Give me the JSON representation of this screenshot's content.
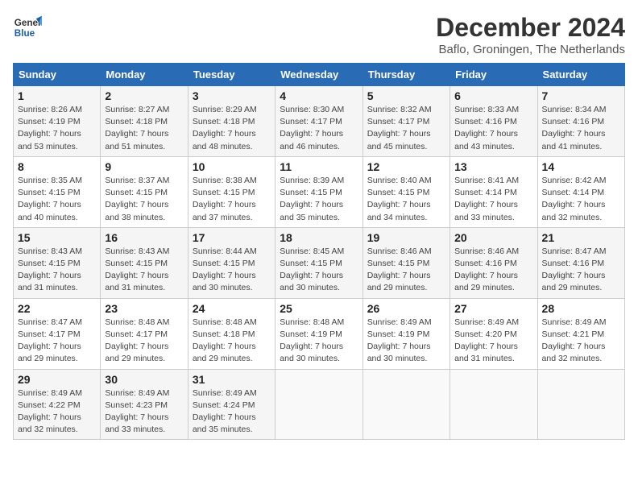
{
  "logo": {
    "line1": "General",
    "line2": "Blue"
  },
  "title": "December 2024",
  "subtitle": "Baflo, Groningen, The Netherlands",
  "days_of_week": [
    "Sunday",
    "Monday",
    "Tuesday",
    "Wednesday",
    "Thursday",
    "Friday",
    "Saturday"
  ],
  "weeks": [
    [
      {
        "day": "1",
        "info": "Sunrise: 8:26 AM\nSunset: 4:19 PM\nDaylight: 7 hours\nand 53 minutes."
      },
      {
        "day": "2",
        "info": "Sunrise: 8:27 AM\nSunset: 4:18 PM\nDaylight: 7 hours\nand 51 minutes."
      },
      {
        "day": "3",
        "info": "Sunrise: 8:29 AM\nSunset: 4:18 PM\nDaylight: 7 hours\nand 48 minutes."
      },
      {
        "day": "4",
        "info": "Sunrise: 8:30 AM\nSunset: 4:17 PM\nDaylight: 7 hours\nand 46 minutes."
      },
      {
        "day": "5",
        "info": "Sunrise: 8:32 AM\nSunset: 4:17 PM\nDaylight: 7 hours\nand 45 minutes."
      },
      {
        "day": "6",
        "info": "Sunrise: 8:33 AM\nSunset: 4:16 PM\nDaylight: 7 hours\nand 43 minutes."
      },
      {
        "day": "7",
        "info": "Sunrise: 8:34 AM\nSunset: 4:16 PM\nDaylight: 7 hours\nand 41 minutes."
      }
    ],
    [
      {
        "day": "8",
        "info": "Sunrise: 8:35 AM\nSunset: 4:15 PM\nDaylight: 7 hours\nand 40 minutes."
      },
      {
        "day": "9",
        "info": "Sunrise: 8:37 AM\nSunset: 4:15 PM\nDaylight: 7 hours\nand 38 minutes."
      },
      {
        "day": "10",
        "info": "Sunrise: 8:38 AM\nSunset: 4:15 PM\nDaylight: 7 hours\nand 37 minutes."
      },
      {
        "day": "11",
        "info": "Sunrise: 8:39 AM\nSunset: 4:15 PM\nDaylight: 7 hours\nand 35 minutes."
      },
      {
        "day": "12",
        "info": "Sunrise: 8:40 AM\nSunset: 4:15 PM\nDaylight: 7 hours\nand 34 minutes."
      },
      {
        "day": "13",
        "info": "Sunrise: 8:41 AM\nSunset: 4:14 PM\nDaylight: 7 hours\nand 33 minutes."
      },
      {
        "day": "14",
        "info": "Sunrise: 8:42 AM\nSunset: 4:14 PM\nDaylight: 7 hours\nand 32 minutes."
      }
    ],
    [
      {
        "day": "15",
        "info": "Sunrise: 8:43 AM\nSunset: 4:15 PM\nDaylight: 7 hours\nand 31 minutes."
      },
      {
        "day": "16",
        "info": "Sunrise: 8:43 AM\nSunset: 4:15 PM\nDaylight: 7 hours\nand 31 minutes."
      },
      {
        "day": "17",
        "info": "Sunrise: 8:44 AM\nSunset: 4:15 PM\nDaylight: 7 hours\nand 30 minutes."
      },
      {
        "day": "18",
        "info": "Sunrise: 8:45 AM\nSunset: 4:15 PM\nDaylight: 7 hours\nand 30 minutes."
      },
      {
        "day": "19",
        "info": "Sunrise: 8:46 AM\nSunset: 4:15 PM\nDaylight: 7 hours\nand 29 minutes."
      },
      {
        "day": "20",
        "info": "Sunrise: 8:46 AM\nSunset: 4:16 PM\nDaylight: 7 hours\nand 29 minutes."
      },
      {
        "day": "21",
        "info": "Sunrise: 8:47 AM\nSunset: 4:16 PM\nDaylight: 7 hours\nand 29 minutes."
      }
    ],
    [
      {
        "day": "22",
        "info": "Sunrise: 8:47 AM\nSunset: 4:17 PM\nDaylight: 7 hours\nand 29 minutes."
      },
      {
        "day": "23",
        "info": "Sunrise: 8:48 AM\nSunset: 4:17 PM\nDaylight: 7 hours\nand 29 minutes."
      },
      {
        "day": "24",
        "info": "Sunrise: 8:48 AM\nSunset: 4:18 PM\nDaylight: 7 hours\nand 29 minutes."
      },
      {
        "day": "25",
        "info": "Sunrise: 8:48 AM\nSunset: 4:19 PM\nDaylight: 7 hours\nand 30 minutes."
      },
      {
        "day": "26",
        "info": "Sunrise: 8:49 AM\nSunset: 4:19 PM\nDaylight: 7 hours\nand 30 minutes."
      },
      {
        "day": "27",
        "info": "Sunrise: 8:49 AM\nSunset: 4:20 PM\nDaylight: 7 hours\nand 31 minutes."
      },
      {
        "day": "28",
        "info": "Sunrise: 8:49 AM\nSunset: 4:21 PM\nDaylight: 7 hours\nand 32 minutes."
      }
    ],
    [
      {
        "day": "29",
        "info": "Sunrise: 8:49 AM\nSunset: 4:22 PM\nDaylight: 7 hours\nand 32 minutes."
      },
      {
        "day": "30",
        "info": "Sunrise: 8:49 AM\nSunset: 4:23 PM\nDaylight: 7 hours\nand 33 minutes."
      },
      {
        "day": "31",
        "info": "Sunrise: 8:49 AM\nSunset: 4:24 PM\nDaylight: 7 hours\nand 35 minutes."
      },
      {
        "day": "",
        "info": ""
      },
      {
        "day": "",
        "info": ""
      },
      {
        "day": "",
        "info": ""
      },
      {
        "day": "",
        "info": ""
      }
    ]
  ]
}
